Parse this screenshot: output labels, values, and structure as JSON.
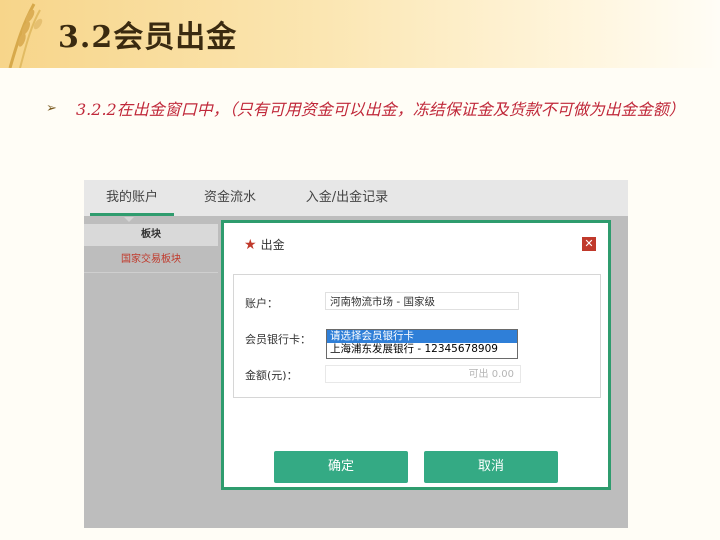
{
  "slide": {
    "title": "3.2会员出金",
    "bullet_arrow": "➢",
    "bullet_text": "3.2.2在出金窗口中，（只有可用资金可以出金，冻结保证金及货款不可做为出金金额）"
  },
  "app": {
    "tabs": [
      {
        "label": "我的账户",
        "active": true
      },
      {
        "label": "资金流水",
        "active": false
      },
      {
        "label": "入金/出金记录",
        "active": false
      }
    ],
    "sidebar": {
      "header": "板块",
      "items": [
        "国家交易板块"
      ]
    },
    "modal": {
      "title": "出金",
      "close_symbol": "✕",
      "account_label": "账户：",
      "account_value": "河南物流市场 - 国家级",
      "bank_card_label": "会员银行卡：",
      "bank_card_options": [
        {
          "text": "请选择会员银行卡",
          "selected": true
        },
        {
          "text": "上海浦东发展银行 - 12345678909",
          "selected": false
        }
      ],
      "amount_label": "金额(元)：",
      "amount_placeholder": "可出 0.00",
      "confirm_label": "确定",
      "cancel_label": "取消"
    }
  },
  "colors": {
    "accent_green": "#2f9c6e",
    "button_green": "#34aa84",
    "bullet_red": "#c0283a",
    "close_red": "#c0392b"
  }
}
